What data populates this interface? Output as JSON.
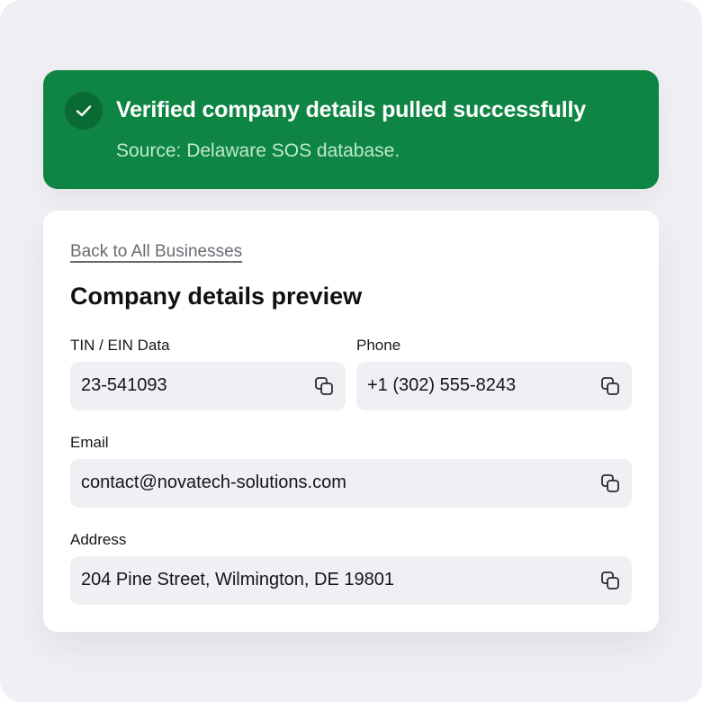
{
  "toast": {
    "title": "Verified company details pulled successfully",
    "subtitle": "Source: Delaware SOS database.",
    "icon": "check-icon",
    "color": "#0e8543"
  },
  "card": {
    "back_link": "Back to All Businesses",
    "title": "Company details preview",
    "fields": {
      "tin": {
        "label": "TIN / EIN Data",
        "value": "23-541093"
      },
      "phone": {
        "label": "Phone",
        "value": "+1 (302) 555-8243"
      },
      "email": {
        "label": "Email",
        "value": "contact@novatech-solutions.com"
      },
      "address": {
        "label": "Address",
        "value": "204 Pine Street, Wilmington, DE 19801"
      }
    },
    "copy_icon": "copy-icon"
  }
}
